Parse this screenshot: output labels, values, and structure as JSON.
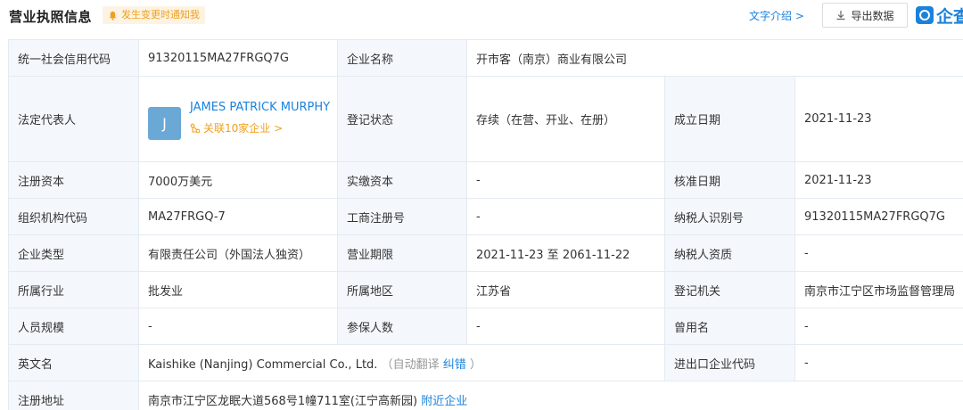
{
  "header": {
    "title": "营业执照信息",
    "notify": "发生变更时通知我",
    "text_intro": "文字介绍 >",
    "export": "导出数据",
    "brand": "企查"
  },
  "rows": {
    "r1": {
      "l1": "统一社会信用代码",
      "v1": "91320115MA27FRGQ7G",
      "l2": "企业名称",
      "v2": "开市客（南京）商业有限公司"
    },
    "r2": {
      "l1": "法定代表人",
      "avatar": "J",
      "rep_name": "JAMES PATRICK MURPHY",
      "rep_rel": "关联10家企业 >",
      "l2": "登记状态",
      "v2": "存续（在营、开业、在册）",
      "l3": "成立日期",
      "v3": "2021-11-23"
    },
    "r3": {
      "l1": "注册资本",
      "v1": "7000万美元",
      "l2": "实缴资本",
      "v2": "-",
      "l3": "核准日期",
      "v3": "2021-11-23"
    },
    "r4": {
      "l1": "组织机构代码",
      "v1": "MA27FRGQ-7",
      "l2": "工商注册号",
      "v2": "-",
      "l3": "纳税人识别号",
      "v3": "91320115MA27FRGQ7G"
    },
    "r5": {
      "l1": "企业类型",
      "v1": "有限责任公司（外国法人独资）",
      "l2": "营业期限",
      "v2": "2021-11-23 至 2061-11-22",
      "l3": "纳税人资质",
      "v3": "-"
    },
    "r6": {
      "l1": "所属行业",
      "v1": "批发业",
      "l2": "所属地区",
      "v2": "江苏省",
      "l3": "登记机关",
      "v3": "南京市江宁区市场监督管理局"
    },
    "r7": {
      "l1": "人员规模",
      "v1": "-",
      "l2": "参保人数",
      "v2": "-",
      "l3": "曾用名",
      "v3": "-"
    },
    "r8": {
      "l1": "英文名",
      "v1": "Kaishike (Nanjing) Commercial Co., Ltd.",
      "v1_auto": "（自动翻译",
      "v1_fix": "纠错",
      "v1_end": "）",
      "l3": "进出口企业代码",
      "v3": "-"
    },
    "r9": {
      "l1": "注册地址",
      "v1": "南京市江宁区龙眠大道568号1幢711室(江宁高新园)",
      "v1_link": "附近企业"
    }
  },
  "colors": {
    "accent": "#1a82dc",
    "label_bg": "#f4f8fd",
    "border": "#e4eaf1",
    "warn": "#f0a020"
  },
  "icons": {
    "notify": "bell-icon",
    "export": "download-icon",
    "relation": "relation-icon",
    "brand": "qcc-logo-icon"
  }
}
